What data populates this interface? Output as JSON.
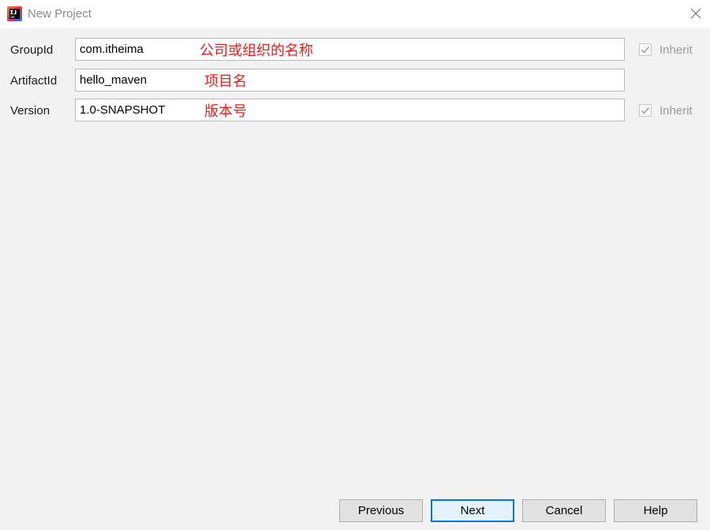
{
  "window": {
    "title": "New Project",
    "app_icon": "intellij-idea-icon",
    "close_icon": "close-icon"
  },
  "form": {
    "group_id": {
      "label": "GroupId",
      "value": "com.itheima",
      "annotation": "公司或组织的名称",
      "inherit_label": "Inherit",
      "inherit_checked": true
    },
    "artifact_id": {
      "label": "ArtifactId",
      "value": "hello_maven",
      "annotation": "项目名"
    },
    "version": {
      "label": "Version",
      "value": "1.0-SNAPSHOT",
      "annotation": "版本号",
      "inherit_label": "Inherit",
      "inherit_checked": true
    }
  },
  "buttons": {
    "previous": "Previous",
    "next": "Next",
    "cancel": "Cancel",
    "help": "Help"
  },
  "colors": {
    "annotation": "#e8211d",
    "primary_button_border": "#0078d7"
  }
}
